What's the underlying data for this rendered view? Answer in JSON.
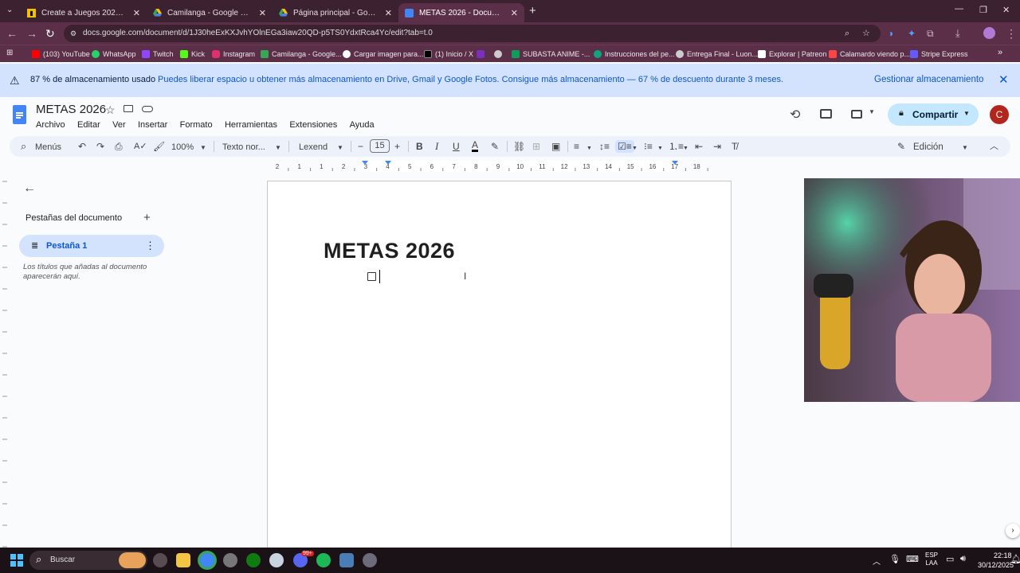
{
  "browser": {
    "tabs": [
      {
        "title": "Create a Juegos 2025 Tier List -",
        "favicon": "tiermaker-icon",
        "color": "#f2c200"
      },
      {
        "title": "Camilanga - Google Drive",
        "favicon": "drive-icon",
        "color": "#34a853"
      },
      {
        "title": "Página principal - Google Drive",
        "favicon": "drive-icon",
        "color": "#34a853"
      },
      {
        "title": "METAS 2026 - Documentos de",
        "favicon": "docs-icon",
        "color": "#4285f4"
      }
    ],
    "url": "docs.google.com/document/d/1J30heExKXJvhYOlnEGa3iaw20QD-p5TS0YdxtRca4Yc/edit?tab=t.0",
    "bookmarks": [
      {
        "label": "(103) YouTube",
        "color": "#ff0000"
      },
      {
        "label": "WhatsApp",
        "color": "#25d366"
      },
      {
        "label": "Twitch",
        "color": "#9146ff"
      },
      {
        "label": "Kick",
        "color": "#53fc18"
      },
      {
        "label": "Instagram",
        "color": "#e1306c"
      },
      {
        "label": "Camilanga - Google...",
        "color": "#34a853"
      },
      {
        "label": "Cargar imagen para...",
        "color": "#ffffff"
      },
      {
        "label": "(1) Inicio / X",
        "color": "#000000"
      },
      {
        "label": "",
        "color": "#7b2fbe"
      },
      {
        "label": "",
        "color": "#cccccc"
      },
      {
        "label": "SUBASTA ANIME -...",
        "color": "#0f9d58"
      },
      {
        "label": "Instrucciones del pe...",
        "color": "#10a37f"
      },
      {
        "label": "Entrega Final - Luon...",
        "color": "#cccccc"
      },
      {
        "label": "Explorar | Patreon",
        "color": "#ffffff"
      },
      {
        "label": "Calamardo viendo p...",
        "color": "#ff4444"
      },
      {
        "label": "Stripe Express",
        "color": "#635bff"
      }
    ]
  },
  "banner": {
    "bold": "87 % de almacenamiento usado",
    "text": "Puedes liberar espacio u obtener más almacenamiento en Drive, Gmail y Google Fotos. Consigue más almacenamiento — 67 % de descuento durante 3 meses.",
    "action": "Gestionar almacenamiento"
  },
  "doc": {
    "title": "METAS 2026",
    "menu": [
      "Archivo",
      "Editar",
      "Ver",
      "Insertar",
      "Formato",
      "Herramientas",
      "Extensiones",
      "Ayuda"
    ],
    "share": "Compartir",
    "avatar": "C"
  },
  "toolbar": {
    "search": "Menús",
    "zoom": "100%",
    "style": "Texto nor...",
    "font": "Lexend",
    "size": "15",
    "mode": "Edición"
  },
  "ruler": [
    "2",
    "1",
    "1",
    "2",
    "3",
    "4",
    "5",
    "6",
    "7",
    "8",
    "9",
    "10",
    "11",
    "12",
    "13",
    "14",
    "15",
    "16",
    "17",
    "18"
  ],
  "sidebar": {
    "heading": "Pestañas del documento",
    "tab": "Pestaña 1",
    "hint": "Los títulos que añadas al documento aparecerán aquí."
  },
  "page": {
    "heading": "METAS 2026"
  },
  "taskbar": {
    "search": "Buscar",
    "lang1": "ESP",
    "lang2": "LAA",
    "time": "22:18",
    "date": "30/12/2025",
    "badge": "99+"
  }
}
